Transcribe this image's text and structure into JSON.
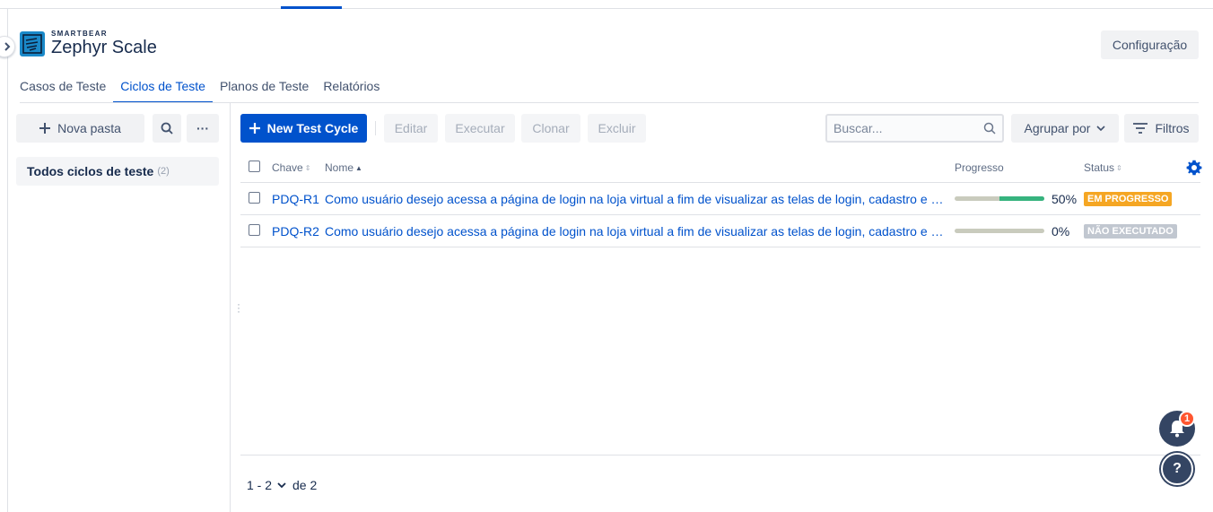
{
  "app": {
    "brand": "SMARTBEAR",
    "product": "Zephyr Scale",
    "config_label": "Configuração"
  },
  "tabs": [
    {
      "label": "Casos de Teste",
      "active": false
    },
    {
      "label": "Ciclos de Teste",
      "active": true
    },
    {
      "label": "Planos de Teste",
      "active": false
    },
    {
      "label": "Relatórios",
      "active": false
    }
  ],
  "sidebar": {
    "new_folder_label": "Nova pasta",
    "more_label": "···",
    "all_cycles_label": "Todos ciclos de teste",
    "all_cycles_count": "(2)"
  },
  "toolbar": {
    "new_label": "New Test Cycle",
    "edit_label": "Editar",
    "execute_label": "Executar",
    "clone_label": "Clonar",
    "delete_label": "Excluir",
    "search_placeholder": "Buscar...",
    "group_label": "Agrupar por",
    "filters_label": "Filtros"
  },
  "table": {
    "columns": {
      "key": "Chave",
      "name": "Nome",
      "progress": "Progresso",
      "status": "Status"
    },
    "rows": [
      {
        "key": "PDQ-R1",
        "name": "Como usuário desejo acessa a página de login na loja virtual a fim de visualizar as telas de login, cadastro e redefinição de senha",
        "progress": 0.5,
        "progress_label": "50%",
        "status": "EM PROGRESSO",
        "status_color": "#f5a623"
      },
      {
        "key": "PDQ-R2",
        "name": "Como usuário desejo acessa a página de login na loja virtual a fim de visualizar as telas de login, cadastro e redefinição de senha",
        "progress": 0,
        "progress_label": "0%",
        "status": "NÃO EXECUTADO",
        "status_color": "#c1c7d0"
      }
    ]
  },
  "pagination": {
    "range": "1 - 2",
    "of": "de 2"
  },
  "notifications": {
    "count": "1"
  },
  "help": {
    "glyph": "?"
  },
  "colors": {
    "primary": "#0052cc",
    "progress_done": "#36b37e",
    "fab": "#344563",
    "badge": "#ff5630"
  }
}
